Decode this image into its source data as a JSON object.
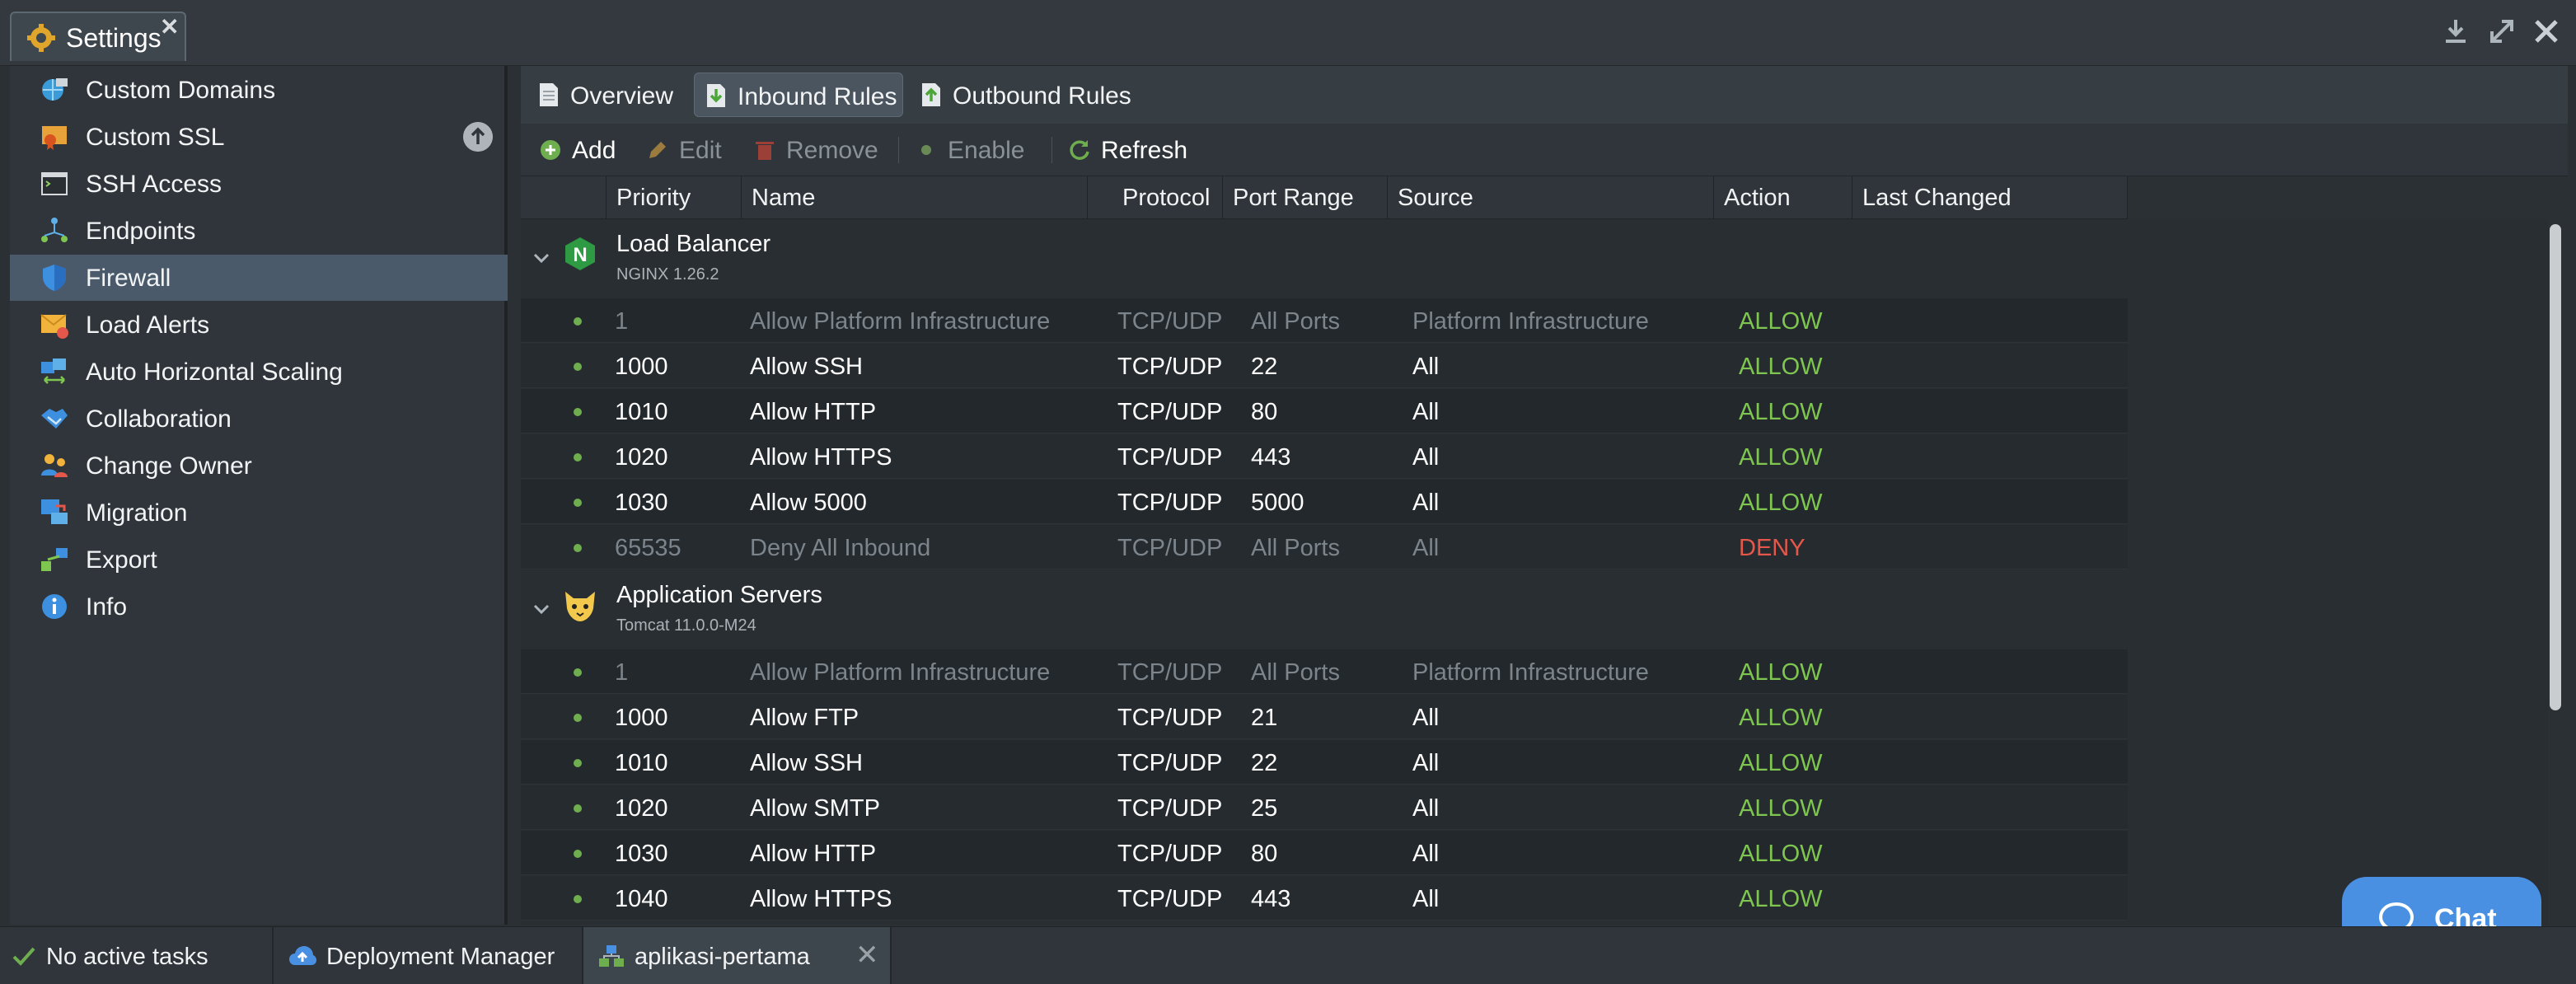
{
  "window": {
    "tab_title": "Settings",
    "close_glyph": "✕",
    "controls": [
      "download-icon",
      "expand-icon",
      "close-icon"
    ]
  },
  "sidebar": {
    "items": [
      {
        "label": "Custom Domains",
        "icon": "globe-icon"
      },
      {
        "label": "Custom SSL",
        "icon": "certificate-icon"
      },
      {
        "label": "SSH Access",
        "icon": "terminal-icon"
      },
      {
        "label": "Endpoints",
        "icon": "endpoints-icon"
      },
      {
        "label": "Firewall",
        "icon": "shield-icon",
        "active": true
      },
      {
        "label": "Load Alerts",
        "icon": "mail-alert-icon"
      },
      {
        "label": "Auto Horizontal Scaling",
        "icon": "scaling-icon"
      },
      {
        "label": "Collaboration",
        "icon": "handshake-icon"
      },
      {
        "label": "Change Owner",
        "icon": "users-icon"
      },
      {
        "label": "Migration",
        "icon": "migration-icon"
      },
      {
        "label": "Export",
        "icon": "export-icon"
      },
      {
        "label": "Info",
        "icon": "info-icon"
      }
    ]
  },
  "tabs": [
    {
      "label": "Overview",
      "icon": "document-icon"
    },
    {
      "label": "Inbound Rules",
      "icon": "inbound-icon",
      "active": true
    },
    {
      "label": "Outbound Rules",
      "icon": "outbound-icon"
    }
  ],
  "toolbar": {
    "add": "Add",
    "edit": "Edit",
    "remove": "Remove",
    "enable": "Enable",
    "refresh": "Refresh"
  },
  "columns": {
    "priority": "Priority",
    "name": "Name",
    "protocol": "Protocol",
    "port_range": "Port Range",
    "source": "Source",
    "action": "Action",
    "last_changed": "Last Changed"
  },
  "groups": [
    {
      "name": "Load Balancer",
      "version": "NGINX 1.26.2",
      "logo_letter": "N",
      "rules": [
        {
          "priority": "1",
          "name": "Allow Platform Infrastructure",
          "protocol": "TCP/UDP",
          "ports": "All Ports",
          "source": "Platform Infrastructure",
          "action": "ALLOW",
          "muted": true
        },
        {
          "priority": "1000",
          "name": "Allow SSH",
          "protocol": "TCP/UDP",
          "ports": "22",
          "source": "All",
          "action": "ALLOW"
        },
        {
          "priority": "1010",
          "name": "Allow HTTP",
          "protocol": "TCP/UDP",
          "ports": "80",
          "source": "All",
          "action": "ALLOW"
        },
        {
          "priority": "1020",
          "name": "Allow HTTPS",
          "protocol": "TCP/UDP",
          "ports": "443",
          "source": "All",
          "action": "ALLOW"
        },
        {
          "priority": "1030",
          "name": "Allow 5000",
          "protocol": "TCP/UDP",
          "ports": "5000",
          "source": "All",
          "action": "ALLOW"
        },
        {
          "priority": "65535",
          "name": "Deny All Inbound",
          "protocol": "TCP/UDP",
          "ports": "All Ports",
          "source": "All",
          "action": "DENY",
          "muted": true
        }
      ]
    },
    {
      "name": "Application Servers",
      "version": "Tomcat 11.0.0-M24",
      "rules": [
        {
          "priority": "1",
          "name": "Allow Platform Infrastructure",
          "protocol": "TCP/UDP",
          "ports": "All Ports",
          "source": "Platform Infrastructure",
          "action": "ALLOW",
          "muted": true
        },
        {
          "priority": "1000",
          "name": "Allow FTP",
          "protocol": "TCP/UDP",
          "ports": "21",
          "source": "All",
          "action": "ALLOW"
        },
        {
          "priority": "1010",
          "name": "Allow SSH",
          "protocol": "TCP/UDP",
          "ports": "22",
          "source": "All",
          "action": "ALLOW"
        },
        {
          "priority": "1020",
          "name": "Allow SMTP",
          "protocol": "TCP/UDP",
          "ports": "25",
          "source": "All",
          "action": "ALLOW"
        },
        {
          "priority": "1030",
          "name": "Allow HTTP",
          "protocol": "TCP/UDP",
          "ports": "80",
          "source": "All",
          "action": "ALLOW"
        },
        {
          "priority": "1040",
          "name": "Allow HTTPS",
          "protocol": "TCP/UDP",
          "ports": "443",
          "source": "All",
          "action": "ALLOW"
        }
      ]
    }
  ],
  "chat": {
    "label": "Chat"
  },
  "taskbar": {
    "status": "No active tasks",
    "deployment_manager": "Deployment Manager",
    "env_tab": "aplikasi-pertama"
  },
  "colors": {
    "allow": "#7ec650",
    "deny": "#e4574a",
    "accent": "#4a90e2",
    "active_sidebar": "#4a5a6a"
  }
}
